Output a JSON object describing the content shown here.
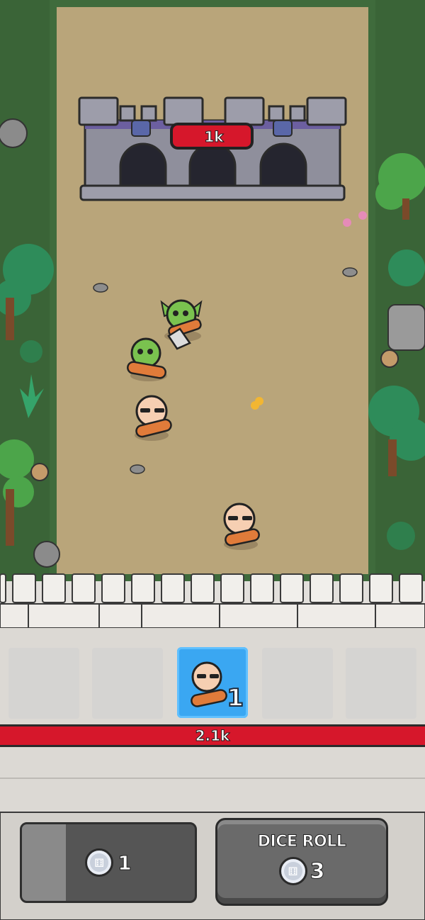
{
  "enemy_castle": {
    "health_label": "1k"
  },
  "player_wall": {
    "health_label": "2.1k"
  },
  "unit_slots": {
    "active_slot": {
      "unit": "bald-fighter",
      "count": "1"
    }
  },
  "buttons": {
    "left": {
      "icon": "dice-coin-icon",
      "value": "1"
    },
    "dice_roll": {
      "label": "DICE ROLL",
      "icon": "dice-coin-icon",
      "cost": "3"
    }
  },
  "units_on_field": [
    {
      "type": "goblin-axe"
    },
    {
      "type": "goblin-club"
    },
    {
      "type": "bald-fighter"
    },
    {
      "type": "bald-fighter"
    }
  ],
  "colors": {
    "grass": "#3f6b3c",
    "dirt": "#b9a57a",
    "stone": "#bcbcbc",
    "health_red": "#d6172b",
    "slot_blue": "#3aa7f2"
  }
}
